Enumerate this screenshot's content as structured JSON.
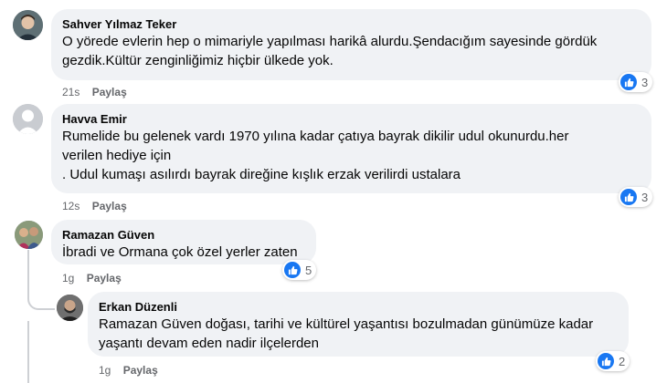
{
  "comments": [
    {
      "author": "Sahver Yılmaz Teker",
      "text": "O yörede evlerin hep o mimariyle yapılması harikâ alurdu.Şendacığım sayesinde gördük\ngezdik.Kültür zenginliğimiz hiçbir ülkede yok.",
      "time": "21s",
      "reply_label": "Paylaş",
      "reactions": "3"
    },
    {
      "author": "Havva Emir",
      "text": "Rumelide bu gelenek vardı 1970 yılına kadar çatıya bayrak dikilir udul okunurdu.her\nverilen hediye için\n. Udul kumaşı asılırdı bayrak direğine kışlık erzak verilirdi ustalara",
      "time": "12s",
      "reply_label": "Paylaş",
      "reactions": "3"
    },
    {
      "author": "Ramazan Güven",
      "text": "İbradi ve Ormana çok özel yerler zaten",
      "time": "1g",
      "reply_label": "Paylaş",
      "reactions": "5"
    },
    {
      "author": "Erkan Düzenli",
      "text": "Ramazan Güven doğası, tarihi ve kültürel yaşantısı bozulmadan günümüze kadar\nyaşantı devam eden nadir ilçelerden",
      "time": "1g",
      "reply_label": "Paylaş",
      "reactions": "2"
    }
  ],
  "colors": {
    "bubble": "#f0f2f5",
    "like": "#1877f2",
    "meta": "#65676b"
  }
}
